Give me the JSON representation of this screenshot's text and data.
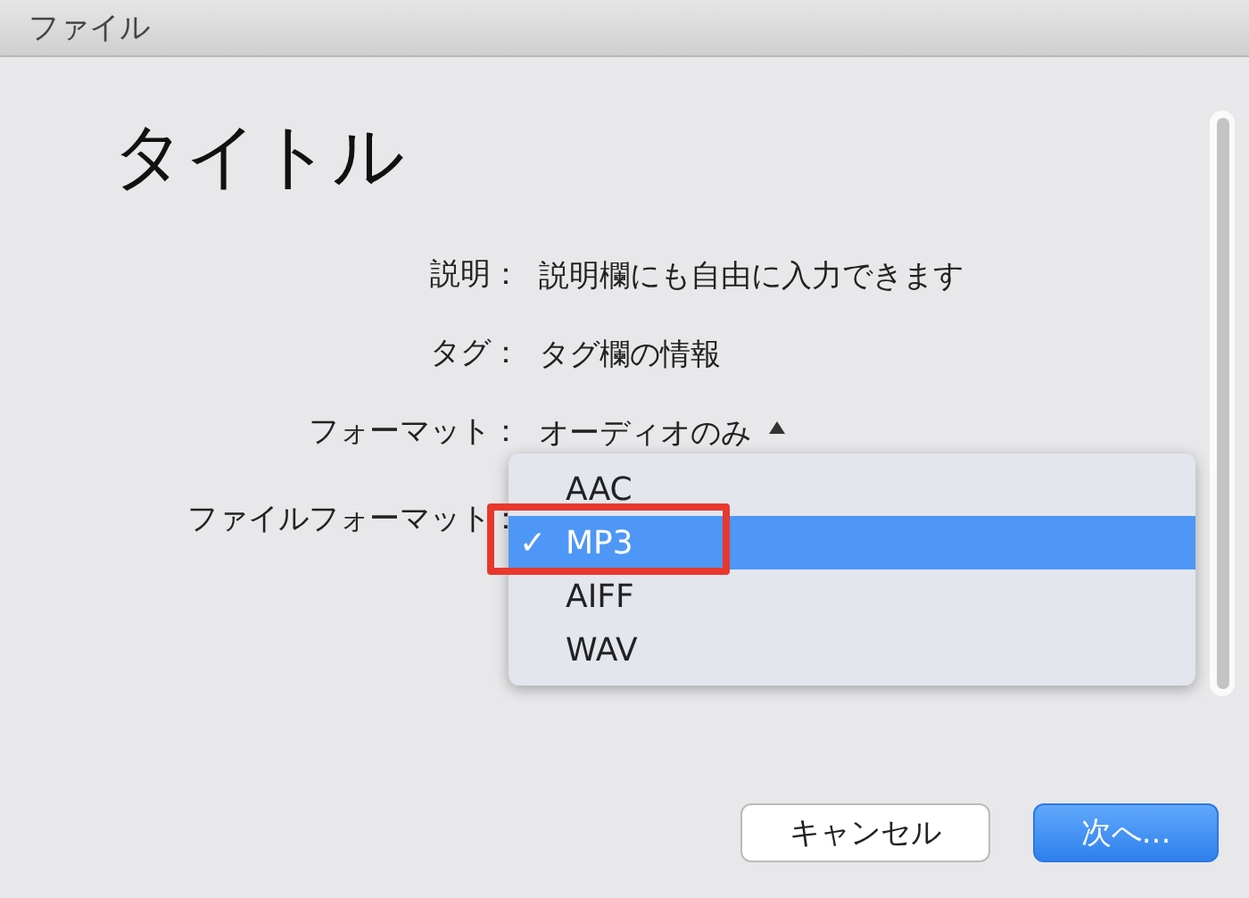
{
  "window": {
    "title": "ファイル"
  },
  "heading": "タイトル",
  "fields": [
    {
      "label": "説明：",
      "value": "説明欄にも自由に入力できます"
    },
    {
      "label": "タグ：",
      "value": "タグ欄の情報"
    },
    {
      "label": "フォーマット：",
      "value": "オーディオのみ"
    },
    {
      "label": "ファイルフォーマット："
    }
  ],
  "menu": {
    "items": [
      {
        "label": "AAC",
        "selected": false,
        "checked": false
      },
      {
        "label": "MP3",
        "selected": true,
        "checked": true
      },
      {
        "label": "AIFF",
        "selected": false,
        "checked": false
      },
      {
        "label": "WAV",
        "selected": false,
        "checked": false
      }
    ],
    "check": "✓"
  },
  "buttons": [
    {
      "label": "キャンセル",
      "kind": "secondary"
    },
    {
      "label": "次へ...",
      "kind": "primary"
    }
  ]
}
